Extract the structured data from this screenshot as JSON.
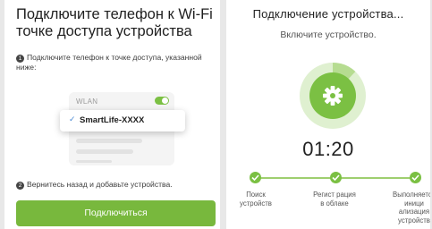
{
  "left": {
    "title": "Подключите телефон к Wi-Fi точке доступа устройства",
    "step1_num": "1",
    "step1": "Подключите телефон к точке доступа, указанной ниже:",
    "wlan_label": "WLAN",
    "wlan_toggle": "on",
    "ssid_check": "✓",
    "ssid": "SmartLife-XXXX",
    "step2_num": "2",
    "step2": "Вернитесь назад и добавьте устройства.",
    "connect_button": "Подключиться",
    "accent": "#78b83d"
  },
  "right": {
    "title": "Подключение устройства...",
    "subtitle": "Включите устройство.",
    "icon": "gear-icon",
    "progress": 0.12,
    "timer": "01:20",
    "steps": [
      {
        "label": "Поиск устройств",
        "done": true
      },
      {
        "label": "Регист рация в облаке",
        "done": true
      },
      {
        "label": "Выполняется иници ализация устройств",
        "done": true
      }
    ],
    "accent": "#7bc043"
  }
}
